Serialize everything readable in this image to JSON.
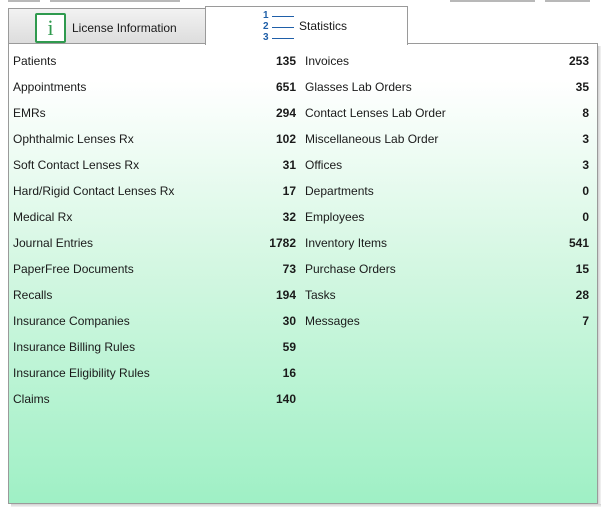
{
  "tabs": {
    "license": {
      "label": "License Information"
    },
    "statistics": {
      "label": "Statistics",
      "icon_numbers": [
        "1",
        "2",
        "3"
      ]
    }
  },
  "statistics": {
    "left": [
      {
        "label": "Patients",
        "value": "135"
      },
      {
        "label": "Appointments",
        "value": "651"
      },
      {
        "label": "EMRs",
        "value": "294"
      },
      {
        "label": "Ophthalmic Lenses Rx",
        "value": "102"
      },
      {
        "label": "Soft Contact Lenses Rx",
        "value": "31"
      },
      {
        "label": "Hard/Rigid Contact Lenses Rx",
        "value": "17"
      },
      {
        "label": "Medical Rx",
        "value": "32"
      },
      {
        "label": "Journal Entries",
        "value": "1782"
      },
      {
        "label": "PaperFree Documents",
        "value": "73"
      },
      {
        "label": "Recalls",
        "value": "194"
      },
      {
        "label": "Insurance Companies",
        "value": "30"
      },
      {
        "label": "Insurance Billing Rules",
        "value": "59"
      },
      {
        "label": "Insurance Eligibility Rules",
        "value": "16"
      },
      {
        "label": "Claims",
        "value": "140"
      }
    ],
    "right": [
      {
        "label": "Invoices",
        "value": "253"
      },
      {
        "label": "Glasses Lab Orders",
        "value": "35"
      },
      {
        "label": "Contact Lenses Lab Order",
        "value": "8"
      },
      {
        "label": "Miscellaneous Lab Order",
        "value": "3"
      },
      {
        "label": "Offices",
        "value": "3"
      },
      {
        "label": "Departments",
        "value": "0"
      },
      {
        "label": "Employees",
        "value": "0"
      },
      {
        "label": "Inventory Items",
        "value": "541"
      },
      {
        "label": "Purchase Orders",
        "value": "15"
      },
      {
        "label": "Tasks",
        "value": "28"
      },
      {
        "label": "Messages",
        "value": "7"
      }
    ]
  },
  "colors": {
    "info_icon": "#2f9a4e",
    "list_icon": "#1f5fa8",
    "panel_gradient_end": "#9ff0c5"
  }
}
